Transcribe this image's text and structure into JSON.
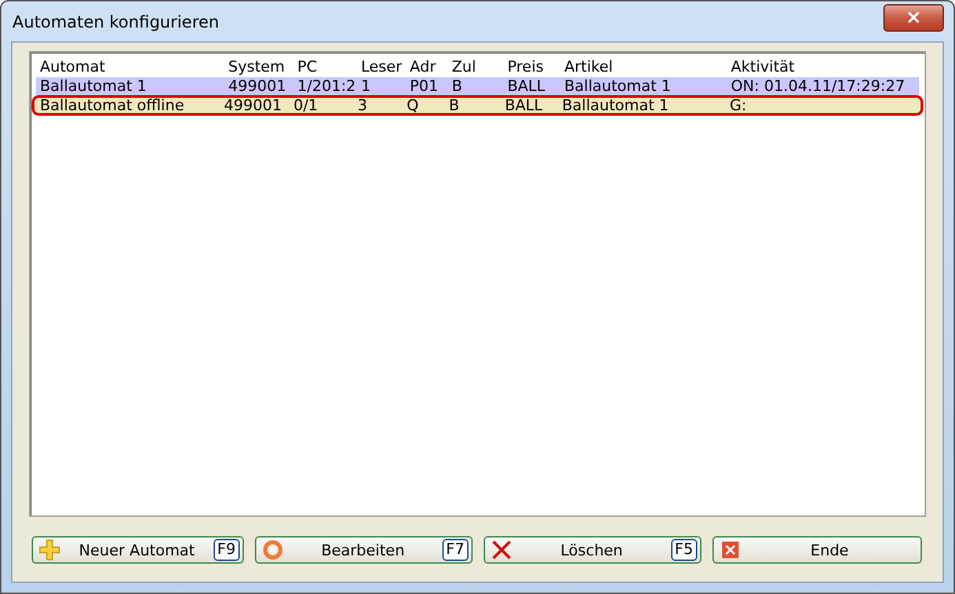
{
  "window": {
    "title": "Automaten konfigurieren",
    "close": "×"
  },
  "table": {
    "columns": [
      "Automat",
      "System",
      "PC",
      "Leser",
      "Adr",
      "Zul",
      "Preis",
      "Artikel",
      "Aktivität"
    ],
    "rows": [
      {
        "cells": [
          "Ballautomat 1",
          "499001",
          "1/201:2",
          "1",
          "P01",
          "B",
          "BALL",
          "Ballautomat 1",
          "ON: 01.04.11/17:29:27"
        ],
        "color": "#c8c8ff",
        "highlighted": false
      },
      {
        "cells": [
          "Ballautomat offline",
          "499001",
          "0/1",
          "3",
          "Q",
          "B",
          "BALL",
          "Ballautomat 1",
          "G:"
        ],
        "color": "#ecebbd",
        "highlighted": true
      }
    ]
  },
  "buttons": [
    {
      "kind": "plus",
      "label": "Neuer Automat",
      "key": "F9"
    },
    {
      "kind": "ring",
      "label": "Bearbeiten",
      "key": "F7"
    },
    {
      "kind": "cross",
      "label": "Löschen",
      "key": "F5"
    },
    {
      "kind": "exit",
      "label": "Ende"
    }
  ]
}
